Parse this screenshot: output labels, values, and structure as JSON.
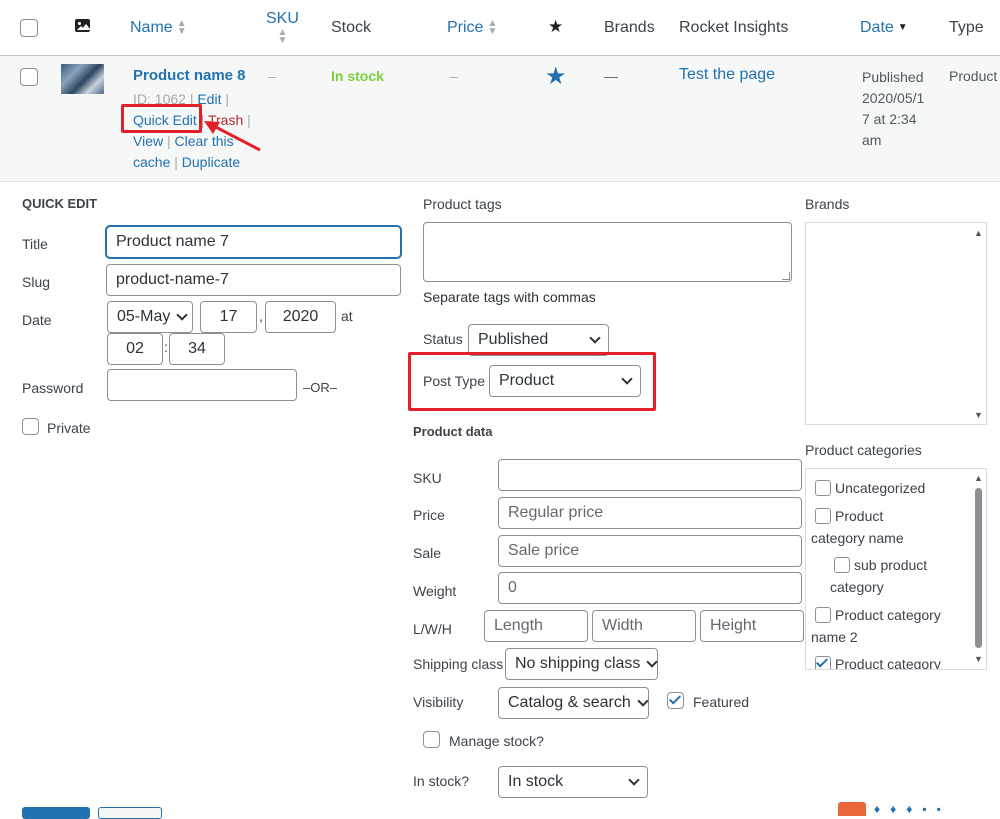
{
  "header": {
    "col_name": "Name",
    "col_sku": "SKU",
    "col_stock": "Stock",
    "col_price": "Price",
    "col_brands": "Brands",
    "col_rocket": "Rocket Insights",
    "col_date": "Date",
    "col_type": "Type"
  },
  "product_row": {
    "name": "Product name 8",
    "sku": "–",
    "stock": "In stock",
    "price": "–",
    "brands": "—",
    "rocket_link": "Test the page",
    "date_line1": "Published",
    "date_line2": "2020/05/1",
    "date_line3": "7 at 2:34",
    "date_line4": "am",
    "type": "Product",
    "id_text": "ID: 1062 |",
    "edit": "Edit",
    "quick_edit": "Quick Edit",
    "trash": "Trash",
    "view": "View",
    "clear_cache_1": "Clear this",
    "clear_cache_2": "cache",
    "duplicate": "Duplicate"
  },
  "quick_edit": {
    "heading": "QUICK EDIT",
    "title_label": "Title",
    "title_value": "Product name 7",
    "slug_label": "Slug",
    "slug_value": "product-name-7",
    "date_label": "Date",
    "month": "05-May",
    "day": "17",
    "year": "2020",
    "at": "at",
    "hour": "02",
    "minute": "34",
    "password_label": "Password",
    "or": "–OR–",
    "private_label": "Private",
    "tags_label": "Product tags",
    "tags_hint": "Separate tags with commas",
    "status_label": "Status",
    "status_value": "Published",
    "post_type_label": "Post Type",
    "post_type_value": "Product",
    "product_data": "Product data",
    "sku_label": "SKU",
    "price_label": "Price",
    "price_placeholder": "Regular price",
    "sale_label": "Sale",
    "sale_placeholder": "Sale price",
    "weight_label": "Weight",
    "weight_placeholder": "0",
    "lwh_label": "L/W/H",
    "length_placeholder": "Length",
    "width_placeholder": "Width",
    "height_placeholder": "Height",
    "shipping_label": "Shipping class",
    "shipping_value": "No shipping class",
    "visibility_label": "Visibility",
    "visibility_value": "Catalog & search",
    "featured_label": "Featured",
    "manage_stock_label": "Manage stock?",
    "in_stock_label": "In stock?",
    "in_stock_value": "In stock",
    "brands_label": "Brands",
    "categories_label": "Product categories",
    "categories": [
      "Uncategorized",
      "Product",
      "category name",
      "sub product",
      "category",
      "Product category",
      "name 2",
      "Product category"
    ]
  },
  "colors": {
    "accent": "#2271b1",
    "in_stock": "#7ad03a",
    "trash": "#b32d2e",
    "highlight": "#e3202a"
  }
}
